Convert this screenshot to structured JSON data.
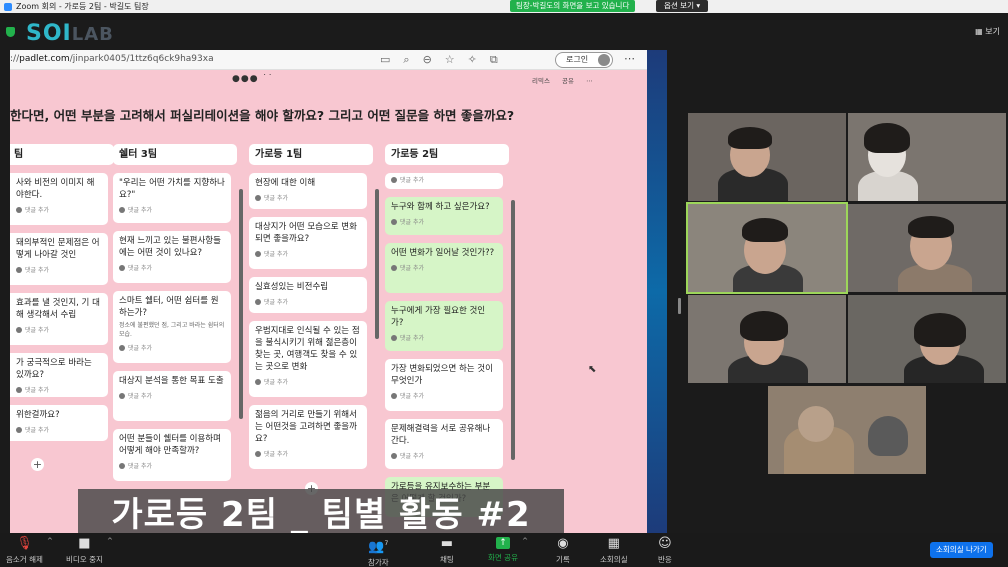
{
  "window": {
    "title": "Zoom 회의 - 가로등 2팀 - 박길도 팀장"
  },
  "banner": {
    "text": "팀장-박길도의 화면을 보고 있습니다",
    "view_options": "옵션 보기"
  },
  "logo": {
    "text": "SOI",
    "suffix": "LAB"
  },
  "view_toggle": "보기",
  "browser": {
    "url_prefix": "://",
    "url_host": "padlet.com",
    "url_path": "/jinpark0405/1ttz6q6ck9ha93xa",
    "login_label": "로그인"
  },
  "padlet": {
    "head_actions": [
      "리믹스",
      "공유",
      "⋯"
    ],
    "question": "한다면, 어떤 부분을 고려해서 퍼실리테이션을 해야 할까요? 그리고 어떤 질문을 하면 좋을까요?",
    "comment_label": "댓글 추가",
    "columns": [
      {
        "title": "팀",
        "cards": [
          {
            "text": "사와 비전의 이미지 해야한다."
          },
          {
            "text": "돼의부적인 문제점은 어떻게 나아갈 것인"
          },
          {
            "text": "효과를 낼 것인지, 기 대해 생각해서 수립"
          },
          {
            "text": "가 궁극적으로 바라는 있까요?"
          },
          {
            "text": "위한걸까요?"
          }
        ]
      },
      {
        "title": "쉘터 3팀",
        "cards": [
          {
            "text": "\"우리는 어떤 가치를 지향하나요?\""
          },
          {
            "text": "현재 느끼고 있는 불편사항들에는 어떤 것이 있나요?"
          },
          {
            "text": "스마트 쉘터, 어떤 쉼터를 원하는가?",
            "sub": "정소에 불편했던 점, 그리고 바라는 쉼터의 모습."
          },
          {
            "text": "대상지 분석을 통한 목표 도출"
          },
          {
            "text": "어떤 분들이 쉘터를 이용하며 어떻게 해야 만족할까?"
          }
        ]
      },
      {
        "title": "가로등 1팀",
        "cards": [
          {
            "text": "현장에 대한 이해"
          },
          {
            "text": "대상지가 어떤 모습으로 변화되면 좋을까요?"
          },
          {
            "text": "실효성있는 비전수립"
          },
          {
            "text": "우범지대로 인식될 수 있는 점을 불식시키기 위해 젊은층이 찾는 곳, 여행객도 찾을 수 있는 곳으로 변화"
          },
          {
            "text": "젊음의 거리로 만들기 위해서는 어떤것을 고려하면 좋을까요?"
          }
        ]
      },
      {
        "title": "가로등 2팀",
        "cards": [
          {
            "text": "",
            "green": false
          },
          {
            "text": "누구와 함께 하고 싶은가요?",
            "green": true
          },
          {
            "text": "어떤 변화가 일어날 것인가??",
            "green": true
          },
          {
            "text": "누구에게 가장 필요한 것인가?",
            "green": true
          },
          {
            "text": "가장 변화되었으면 하는 것이 무엇인가",
            "green": false
          },
          {
            "text": "문제해결력을 서로 공유해나간다.",
            "green": false
          },
          {
            "text": "가로등을 유지보수하는 부분은 어떻게 할 것인가?",
            "green": true
          }
        ]
      }
    ]
  },
  "caption": "가로등 2팀 _ 팀별 활동 #2",
  "toolbar": {
    "mute": "음소거 해제",
    "video": "비디오 중지",
    "participants": "참가자",
    "participants_count": "7",
    "chat": "채팅",
    "share": "화면 공유",
    "record": "기록",
    "breakout": "소회의실",
    "reactions": "반응",
    "leave_breakout": "소회의실 나가기"
  }
}
